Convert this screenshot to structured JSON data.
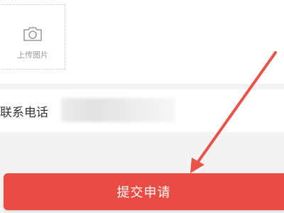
{
  "upload": {
    "label": "上传图片",
    "icon": "camera-icon"
  },
  "contact": {
    "label": "联系电话",
    "value": ""
  },
  "submit": {
    "label": "提交申请"
  },
  "colors": {
    "accent": "#e84c44",
    "annotation_arrow": "#e8534a",
    "background_grey": "#f3f3f3"
  }
}
